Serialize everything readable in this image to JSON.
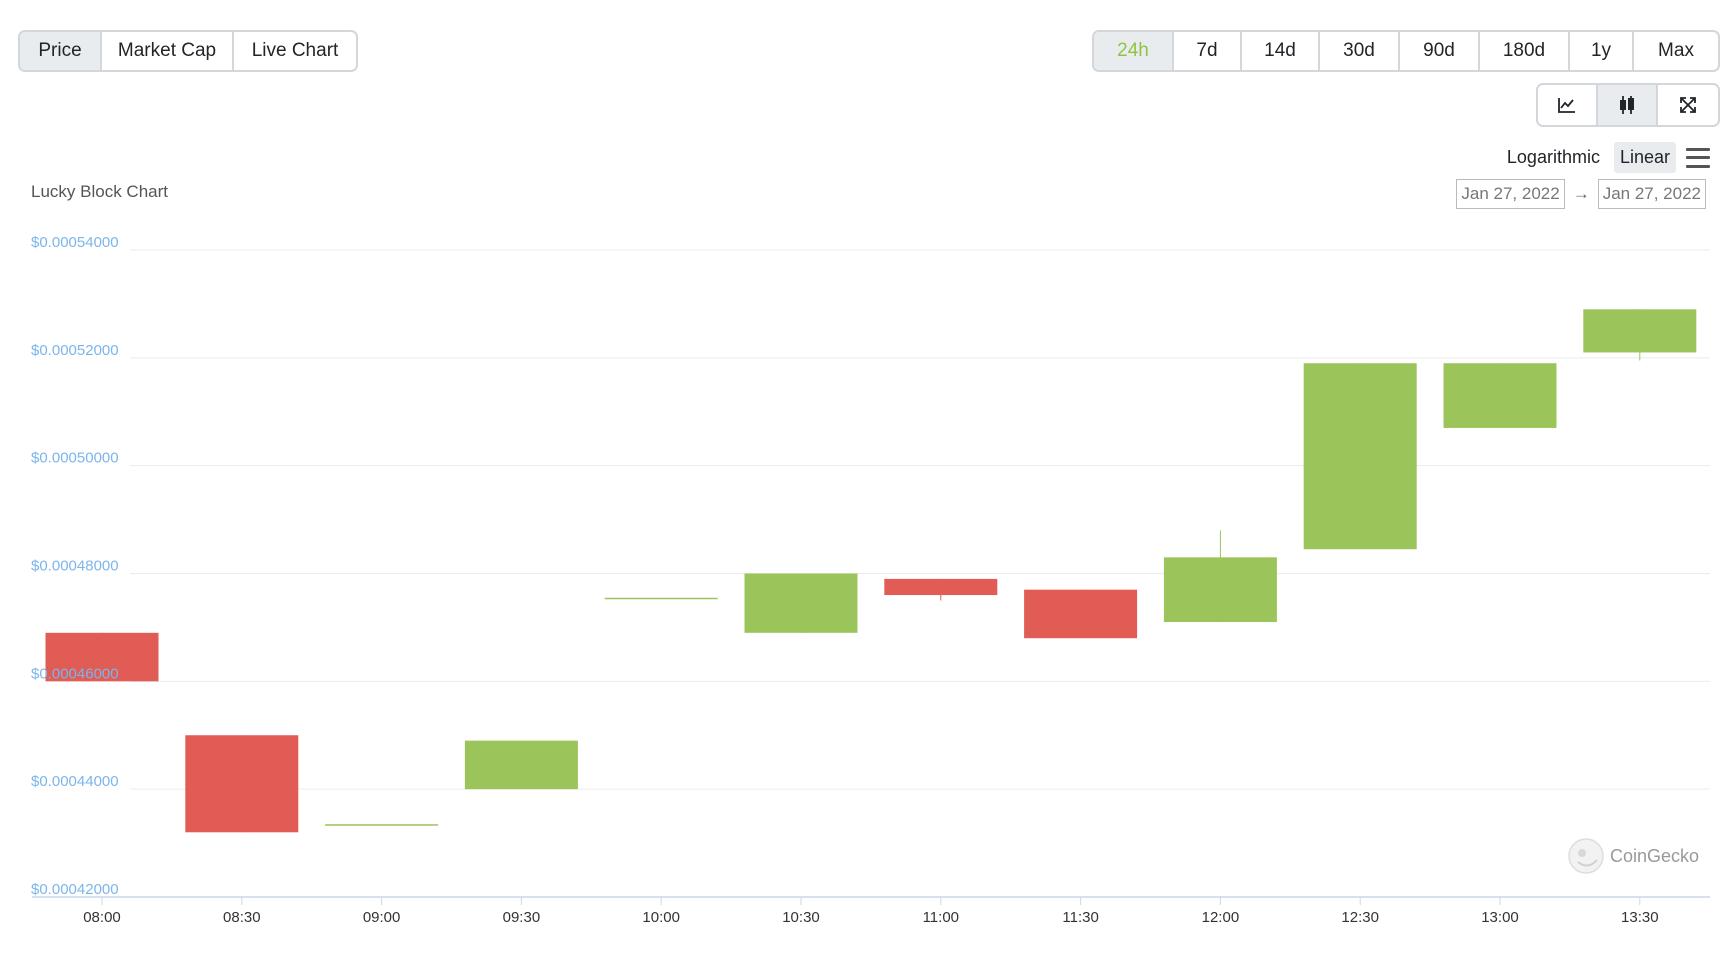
{
  "type_tabs": [
    {
      "label": "Price",
      "active": true
    },
    {
      "label": "Market Cap",
      "active": false
    },
    {
      "label": "Live Chart",
      "active": false
    }
  ],
  "range_tabs": [
    {
      "label": "24h",
      "active": true
    },
    {
      "label": "7d",
      "active": false
    },
    {
      "label": "14d",
      "active": false
    },
    {
      "label": "30d",
      "active": false
    },
    {
      "label": "90d",
      "active": false
    },
    {
      "label": "180d",
      "active": false
    },
    {
      "label": "1y",
      "active": false
    },
    {
      "label": "Max",
      "active": false
    }
  ],
  "view_tabs": [
    {
      "icon": "line-chart-icon"
    },
    {
      "icon": "candlestick-icon"
    },
    {
      "icon": "expand-icon"
    }
  ],
  "scale": {
    "logarithmic_label": "Logarithmic",
    "linear_label": "Linear",
    "active": "Linear",
    "menu_icon": "menu-icon"
  },
  "date_range": {
    "from": "Jan 27, 2022",
    "to": "Jan 27, 2022",
    "arrow": "→"
  },
  "credit": "CoinGecko",
  "colors": {
    "up": "#9bc45a",
    "down": "#e05c55",
    "active_range": "#8dc63f",
    "ytick": "#7cb5ec"
  },
  "chart_data": {
    "type": "candlestick",
    "title": "Lucky Block Chart",
    "y_tick_values": [
      0.00042,
      0.00044,
      0.00046,
      0.00048,
      0.0005,
      0.00052,
      0.00054
    ],
    "y_tick_labels": [
      "$0.00042000",
      "$0.00044000",
      "$0.00046000",
      "$0.00048000",
      "$0.00050000",
      "$0.00052000",
      "$0.00054000"
    ],
    "ylim": [
      0.00042,
      0.00054
    ],
    "x": [
      "08:00",
      "08:30",
      "09:00",
      "09:30",
      "10:00",
      "10:30",
      "11:00",
      "11:30",
      "12:00",
      "12:30",
      "13:00",
      "13:30"
    ],
    "open": [
      0.000469,
      0.00045,
      0.0004335,
      0.00044,
      0.0004755,
      0.000469,
      0.000479,
      0.000477,
      0.000471,
      0.0004845,
      0.000507,
      0.000521
    ],
    "close": [
      0.00046,
      0.000432,
      0.0004335,
      0.000449,
      0.0004755,
      0.00048,
      0.000476,
      0.000468,
      0.000483,
      0.000519,
      0.000519,
      0.000529
    ],
    "high": [
      0.000469,
      0.00045,
      0.0004335,
      0.000449,
      0.0004755,
      0.00048,
      0.000479,
      0.000477,
      0.000488,
      0.000519,
      0.000519,
      0.000529
    ],
    "low": [
      0.00046,
      0.000432,
      0.0004335,
      0.00044,
      0.0004755,
      0.000469,
      0.000475,
      0.000468,
      0.000471,
      0.0004845,
      0.000507,
      0.0005195
    ],
    "grid": true
  }
}
